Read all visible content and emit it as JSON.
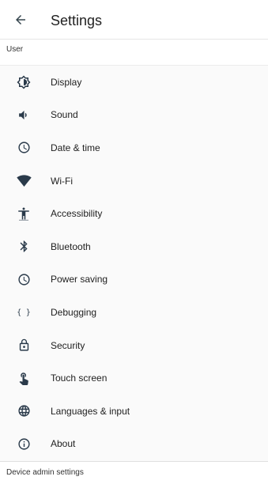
{
  "header": {
    "title": "Settings",
    "back_icon": "arrow-back-icon"
  },
  "sections": {
    "user_label": "User",
    "device_admin_label": "Device admin settings"
  },
  "items": [
    {
      "label": "Display",
      "icon": "brightness-icon"
    },
    {
      "label": "Sound",
      "icon": "volume-icon"
    },
    {
      "label": "Date & time",
      "icon": "clock-icon"
    },
    {
      "label": "Wi-Fi",
      "icon": "wifi-icon"
    },
    {
      "label": "Accessibility",
      "icon": "accessibility-icon"
    },
    {
      "label": "Bluetooth",
      "icon": "bluetooth-icon"
    },
    {
      "label": "Power saving",
      "icon": "clock-icon"
    },
    {
      "label": "Debugging",
      "icon": "braces-icon"
    },
    {
      "label": "Security",
      "icon": "lock-icon"
    },
    {
      "label": "Touch screen",
      "icon": "touch-icon"
    },
    {
      "label": "Languages & input",
      "icon": "globe-icon"
    },
    {
      "label": "About",
      "icon": "info-icon"
    }
  ],
  "colors": {
    "background": "#ffffff",
    "list_background": "#fafafa",
    "icon": "#2a3a4a",
    "text": "#212121"
  }
}
